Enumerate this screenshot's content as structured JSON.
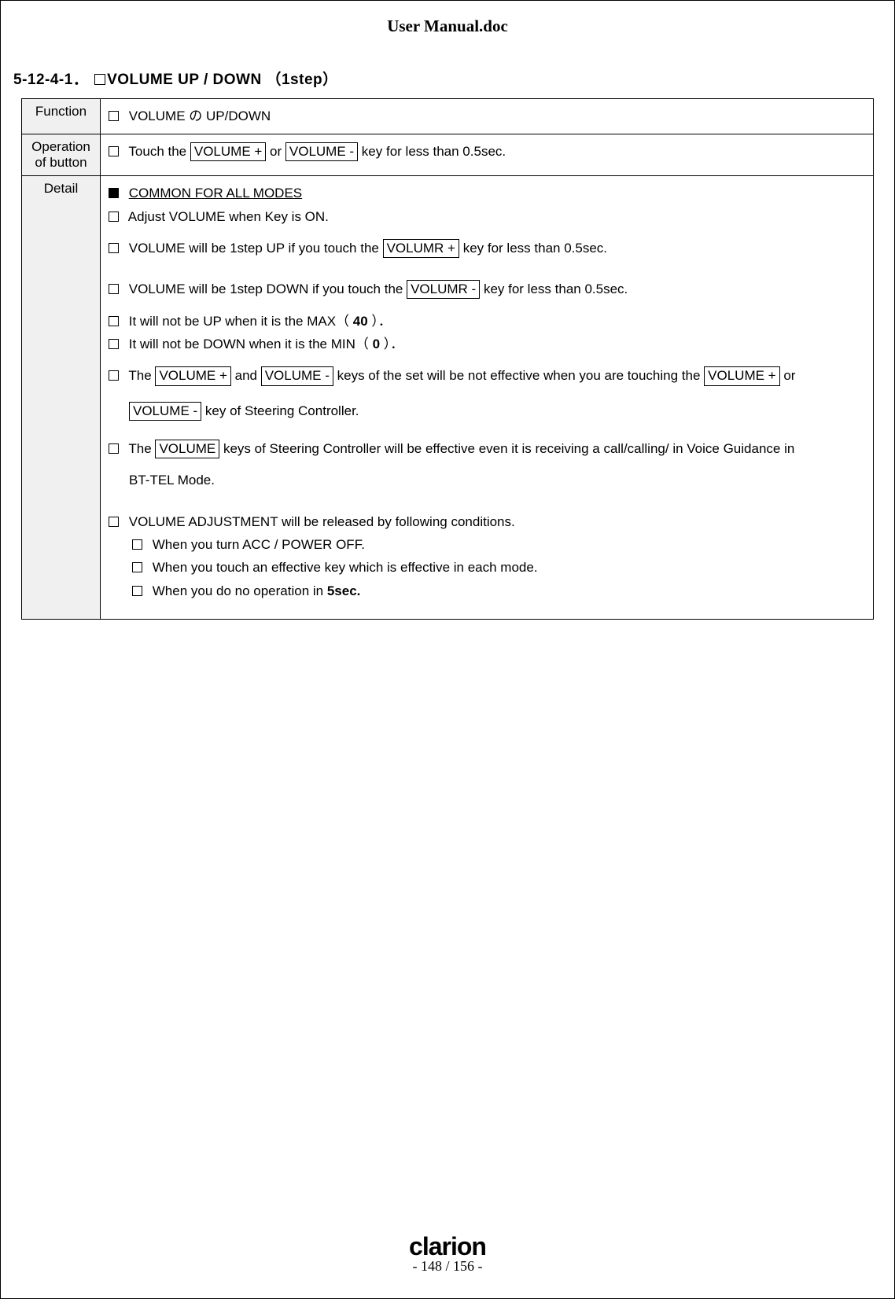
{
  "doc_title": "User Manual.doc",
  "section_number": "5-12-4-1．",
  "section_title": "VOLUME UP / DOWN （1step）",
  "rows": {
    "function": {
      "label": "Function",
      "text": "VOLUME の UP/DOWN"
    },
    "operation": {
      "label": "Operation of button",
      "pre": "Touch the ",
      "key1": "VOLUME +",
      "mid": " or ",
      "key2": "VOLUME -",
      "post": " key for less than 0.5sec."
    },
    "detail": {
      "label": "Detail",
      "common_header": "COMMON FOR ALL MODES",
      "l1": "Adjust VOLUME when Key is ON.",
      "l2_pre": "VOLUME will be 1step  UP if you touch the ",
      "l2_key": "VOLUMR +",
      "l2_post": " key for less than 0.5sec.",
      "l3_pre": "VOLUME will be 1step  DOWN if you touch the ",
      "l3_key": "VOLUMR -",
      "l3_post": " key for less than 0.5sec.",
      "l4_pre": "It will not be UP when it is the MAX（ ",
      "l4_val": "40",
      "l4_post": " ）．",
      "l5_pre": "It will not be DOWN when it is the MIN（ ",
      "l5_val": "0",
      "l5_post": " ）．",
      "l6_pre": "The ",
      "l6_k1": " VOLUME +",
      "l6_mid1": " and ",
      "l6_k2": "VOLUME -",
      "l6_mid2": " keys of the set will be not effective when you are touching the ",
      "l6_k3": "VOLUME +",
      "l6_post": " or",
      "l6b_k": "VOLUME  -",
      "l6b_post": " key of Steering Controller.",
      "l7_pre": "The ",
      "l7_k": "VOLUME",
      "l7_post": " keys of Steering Controller will be effective even it is receiving a call/calling/ in Voice Guidance in",
      "l7b": "BT-TEL Mode.",
      "l8": "VOLUME ADJUSTMENT will be released by following conditions.",
      "l8a": "When you turn ACC / POWER  OFF.",
      "l8b": "When you touch an effective key which is effective in each mode.",
      "l8c_pre": "When you do no operation in ",
      "l8c_b": "5sec."
    }
  },
  "footer": {
    "brand": "clarion",
    "page": "- 148 / 156 -"
  }
}
